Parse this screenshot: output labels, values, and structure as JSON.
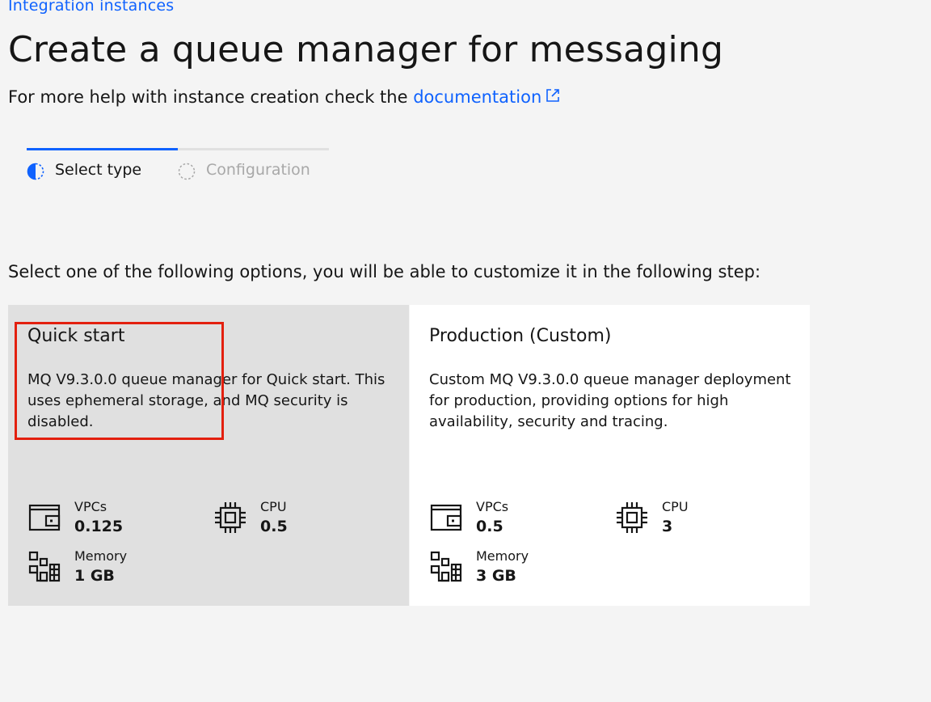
{
  "breadcrumb": {
    "label": "Integration instances"
  },
  "page": {
    "title": "Create a queue manager for messaging",
    "help_prefix": "For more help with instance creation check the ",
    "help_link": "documentation"
  },
  "progress": {
    "steps": [
      {
        "label": "Select type",
        "state": "current"
      },
      {
        "label": "Configuration",
        "state": "incomplete"
      }
    ]
  },
  "instruction": "Select one of the following options, you will be able to customize it in the following step:",
  "tiles": [
    {
      "title": "Quick start",
      "description": "MQ V9.3.0.0 queue manager for Quick start. This uses ephemeral storage, and MQ security is disabled.",
      "selected": true,
      "stats": {
        "vpcs": {
          "label": "VPCs",
          "value": "0.125",
          "icon": "wallet-icon"
        },
        "cpu": {
          "label": "CPU",
          "value": "0.5",
          "icon": "chip-icon"
        },
        "memory": {
          "label": "Memory",
          "value": "1 GB",
          "icon": "memory-grid-icon"
        }
      }
    },
    {
      "title": "Production (Custom)",
      "description": "Custom MQ V9.3.0.0 queue manager deployment for production, providing options for high availability, security and tracing.",
      "selected": false,
      "stats": {
        "vpcs": {
          "label": "VPCs",
          "value": "0.5",
          "icon": "wallet-icon"
        },
        "cpu": {
          "label": "CPU",
          "value": "3",
          "icon": "chip-icon"
        },
        "memory": {
          "label": "Memory",
          "value": "3 GB",
          "icon": "memory-grid-icon"
        }
      }
    }
  ],
  "colors": {
    "link": "#0f62fe",
    "background": "#f4f4f4",
    "selected_tile": "#e0e0e0",
    "tile": "#ffffff",
    "highlight": "#e3200f"
  }
}
